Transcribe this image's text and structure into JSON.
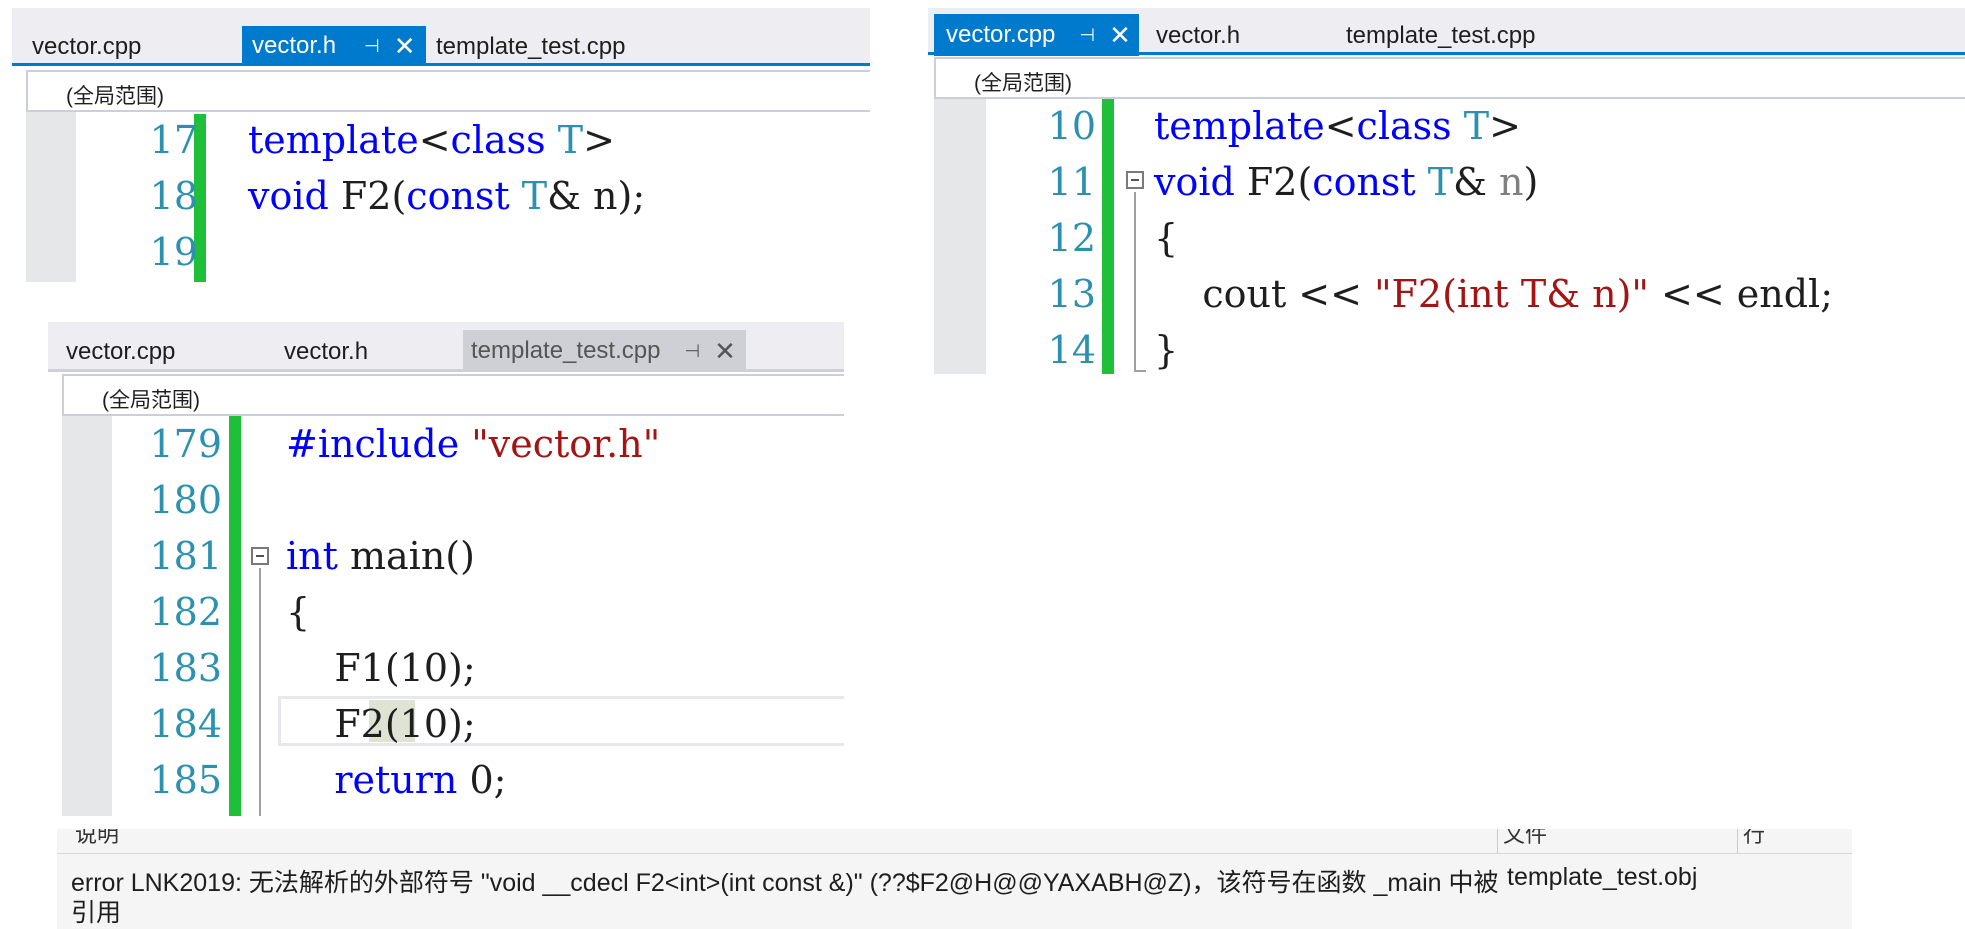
{
  "panel1": {
    "tabs": [
      "vector.cpp",
      "vector.h",
      "template_test.cpp"
    ],
    "scope": "(全局范围)",
    "lines": [
      {
        "num": "17",
        "segs": [
          [
            "kw",
            "template"
          ],
          [
            "pl",
            "<"
          ],
          [
            "kw",
            "class"
          ],
          [
            "pl",
            " "
          ],
          [
            "ty",
            "T"
          ],
          [
            "pl",
            ">"
          ]
        ]
      },
      {
        "num": "18",
        "segs": [
          [
            "kw",
            "void"
          ],
          [
            "pl",
            " F2("
          ],
          [
            "kw",
            "const"
          ],
          [
            "pl",
            " "
          ],
          [
            "ty",
            "T"
          ],
          [
            "pl",
            "& n);"
          ]
        ]
      },
      {
        "num": "19",
        "segs": []
      }
    ]
  },
  "panel2": {
    "tabs": [
      "vector.cpp",
      "vector.h",
      "template_test.cpp"
    ],
    "scope": "(全局范围)",
    "lines": [
      {
        "num": "10",
        "segs": [
          [
            "kw",
            "template"
          ],
          [
            "pl",
            "<"
          ],
          [
            "kw",
            "class"
          ],
          [
            "pl",
            " "
          ],
          [
            "ty",
            "T"
          ],
          [
            "pl",
            ">"
          ]
        ]
      },
      {
        "num": "11",
        "segs": [
          [
            "kw",
            "void"
          ],
          [
            "pl",
            " F2("
          ],
          [
            "kw",
            "const"
          ],
          [
            "pl",
            " "
          ],
          [
            "ty",
            "T"
          ],
          [
            "pl",
            "& "
          ],
          [
            "par",
            "n"
          ],
          [
            "pl",
            ")"
          ]
        ]
      },
      {
        "num": "12",
        "segs": [
          [
            "pl",
            "{"
          ]
        ]
      },
      {
        "num": "13",
        "segs": [
          [
            "pl",
            "    cout << "
          ],
          [
            "str",
            "\"F2(int T& n)\""
          ],
          [
            "pl",
            " << endl;"
          ]
        ]
      },
      {
        "num": "14",
        "segs": [
          [
            "pl",
            "}"
          ]
        ]
      }
    ]
  },
  "panel3": {
    "tabs": [
      "vector.cpp",
      "vector.h",
      "template_test.cpp"
    ],
    "scope": "(全局范围)",
    "lines": [
      {
        "num": "179",
        "segs": [
          [
            "kw",
            "#include"
          ],
          [
            "pl",
            " "
          ],
          [
            "str",
            "\"vector.h\""
          ]
        ]
      },
      {
        "num": "180",
        "segs": []
      },
      {
        "num": "181",
        "segs": [
          [
            "kw",
            "int"
          ],
          [
            "pl",
            " main()"
          ]
        ]
      },
      {
        "num": "182",
        "segs": [
          [
            "pl",
            "{"
          ]
        ]
      },
      {
        "num": "183",
        "segs": [
          [
            "pl",
            "    F1(10);"
          ]
        ]
      },
      {
        "num": "184",
        "segs": [
          [
            "pl",
            "    F2(10);"
          ]
        ]
      },
      {
        "num": "185",
        "segs": [
          [
            "pl",
            "    "
          ],
          [
            "kw",
            "return"
          ],
          [
            "pl",
            " 0;"
          ]
        ]
      }
    ]
  },
  "error_list": {
    "col_description": "说明",
    "col_file": "文件",
    "col_line": "行",
    "message": "error LNK2019: 无法解析的外部符号 \"void __cdecl F2<int>(int const &)\" (??$F2@H@@YAXABH@Z)，该符号在函数 _main 中被",
    "message_cont": "引用",
    "file": "template_test.obj"
  },
  "colors": {
    "accent": "#007acc",
    "change_bar": "#1fbf3a",
    "keyword": "#0000ff",
    "type": "#2b91af",
    "string": "#a31515"
  }
}
